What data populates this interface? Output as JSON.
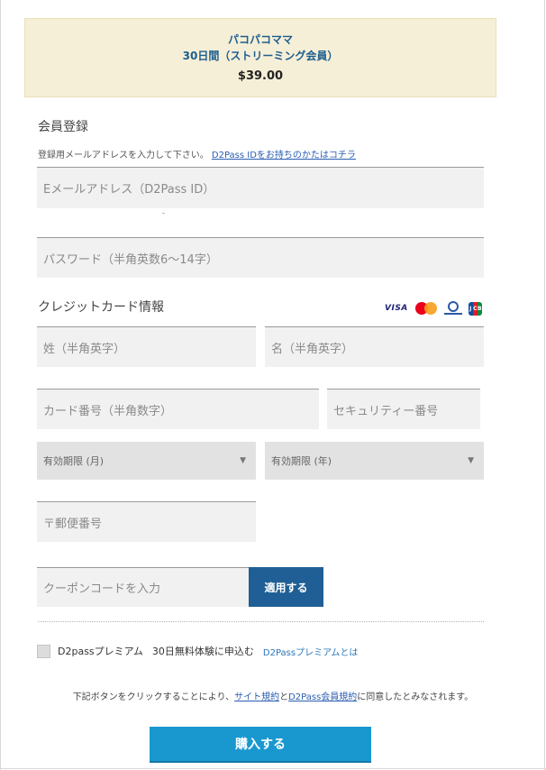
{
  "product": {
    "name": "パコパコママ",
    "plan": "30日間（ストリーミング会員）",
    "price": "$39.00"
  },
  "registration": {
    "title": "会員登録",
    "help_text": "登録用メールアドレスを入力して下さい。",
    "help_link": "D2Pass IDをお持ちのかたはコチラ",
    "email_placeholder": "Eメールアドレス（D2Pass ID）",
    "password_placeholder": "パスワード（半角英数6〜14字）"
  },
  "credit_card": {
    "title": "クレジットカード情報",
    "brands": [
      "VISA",
      "Mastercard",
      "Diners Club",
      "JCB"
    ],
    "visa_label": "VISA",
    "jcb_letters": [
      "J",
      "C",
      "B"
    ],
    "last_name_placeholder": "姓（半角英字）",
    "first_name_placeholder": "名（半角英字）",
    "card_number_placeholder": "カード番号（半角数字）",
    "security_code_placeholder": "セキュリティー番号",
    "expiry_month": "有効期限 (月)",
    "expiry_year": "有効期限 (年)",
    "postal_code_placeholder": "〒郵便番号"
  },
  "coupon": {
    "placeholder": "クーポンコードを入力",
    "apply_label": "適用する"
  },
  "premium": {
    "label": "D2passプレミアム",
    "trial": "30日無料体験に申込む",
    "link": "D2Passプレミアムとは"
  },
  "agreement": {
    "prefix": "下記ボタンをクリックすることにより、",
    "terms_link": "サイト規約",
    "and": "と",
    "member_terms_link": "D2Pass会員規約",
    "suffix": "に同意したとみなされます。"
  },
  "purchase_label": "購入する",
  "colors": {
    "product_bg": "#f6efd7",
    "product_text": "#1c5e8f",
    "apply_button": "#1f5f95",
    "buy_button": "#1998cf",
    "link": "#2a5db0"
  }
}
